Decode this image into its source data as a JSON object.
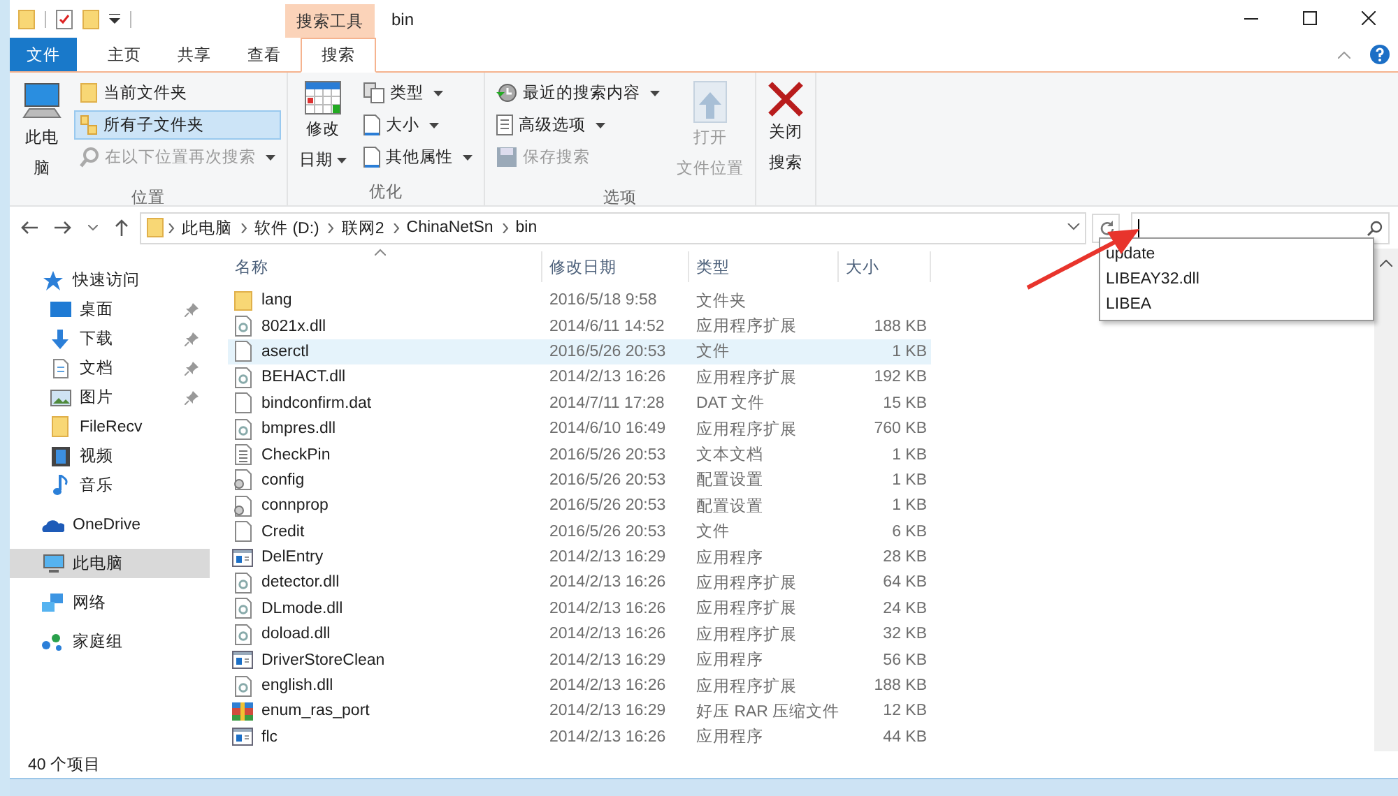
{
  "window": {
    "title": "bin",
    "context_tab": "搜索工具"
  },
  "ribbon_tabs": [
    {
      "label": "文件",
      "kind": "file",
      "selected": false
    },
    {
      "label": "主页",
      "kind": "tab",
      "selected": false
    },
    {
      "label": "共享",
      "kind": "tab",
      "selected": false
    },
    {
      "label": "查看",
      "kind": "tab",
      "selected": false
    },
    {
      "label": "搜索",
      "kind": "tab",
      "selected": true
    }
  ],
  "ribbon_groups": [
    {
      "label": "位置",
      "items": [
        {
          "kind": "large",
          "lines": [
            "此电",
            "脑"
          ],
          "disabled": false,
          "dropdown": false
        },
        {
          "kind": "small",
          "label": "当前文件夹",
          "selected": false,
          "disabled": false,
          "dropdown": false
        },
        {
          "kind": "small",
          "label": "所有子文件夹",
          "selected": true,
          "disabled": false,
          "dropdown": false
        },
        {
          "kind": "small",
          "label": "在以下位置再次搜索",
          "selected": false,
          "disabled": true,
          "dropdown": true
        }
      ]
    },
    {
      "label": "优化",
      "items": [
        {
          "kind": "large",
          "lines": [
            "修改",
            "日期"
          ],
          "disabled": false,
          "dropdown": true
        },
        {
          "kind": "small",
          "label": "类型",
          "selected": false,
          "disabled": false,
          "dropdown": true
        },
        {
          "kind": "small",
          "label": "大小",
          "selected": false,
          "disabled": false,
          "dropdown": true
        },
        {
          "kind": "small",
          "label": "其他属性",
          "selected": false,
          "disabled": false,
          "dropdown": true
        }
      ]
    },
    {
      "label": "选项",
      "items": [
        {
          "kind": "small",
          "label": "最近的搜索内容",
          "selected": false,
          "disabled": false,
          "dropdown": true
        },
        {
          "kind": "small",
          "label": "高级选项",
          "selected": false,
          "disabled": false,
          "dropdown": true
        },
        {
          "kind": "small",
          "label": "保存搜索",
          "selected": false,
          "disabled": true,
          "dropdown": false
        },
        {
          "kind": "large",
          "lines": [
            "打开",
            "文件位置"
          ],
          "disabled": true,
          "dropdown": false
        }
      ]
    },
    {
      "items": [
        {
          "kind": "large",
          "lines": [
            "关闭",
            "搜索"
          ],
          "disabled": false,
          "dropdown": false
        }
      ]
    }
  ],
  "address": {
    "crumbs": [
      "此电脑",
      "软件 (D:)",
      "联网2",
      "ChinaNetSn",
      "bin"
    ]
  },
  "search": {
    "suggestions": [
      "update",
      "LIBEAY32.dll",
      "LIBEA"
    ]
  },
  "navigation": [
    {
      "label": "快速访问",
      "selected": false,
      "children": [
        {
          "label": "桌面",
          "pinned": true
        },
        {
          "label": "下载",
          "pinned": true
        },
        {
          "label": "文档",
          "pinned": true
        },
        {
          "label": "图片",
          "pinned": true
        },
        {
          "label": "FileRecv",
          "pinned": false
        },
        {
          "label": "视频",
          "pinned": false
        },
        {
          "label": "音乐",
          "pinned": false
        }
      ]
    },
    {
      "label": "OneDrive",
      "selected": false
    },
    {
      "label": "此电脑",
      "selected": true
    },
    {
      "label": "网络",
      "selected": false
    },
    {
      "label": "家庭组",
      "selected": false
    }
  ],
  "table": {
    "columns": [
      {
        "label": "名称",
        "sorted": true
      },
      {
        "label": "修改日期",
        "sorted": false
      },
      {
        "label": "类型",
        "sorted": false
      },
      {
        "label": "大小",
        "sorted": false
      }
    ],
    "rows": [
      {
        "kind": "folder",
        "name": "lang",
        "date": "2016/5/18 9:58",
        "type": "文件夹",
        "selected": false
      },
      {
        "kind": "dll",
        "name": "8021x.dll",
        "date": "2014/6/11 14:52",
        "type": "应用程序扩展",
        "size": "188 KB",
        "selected": false
      },
      {
        "kind": "file",
        "name": "aserctl",
        "date": "2016/5/26 20:53",
        "type": "文件",
        "size": "1 KB",
        "selected": true
      },
      {
        "kind": "dll",
        "name": "BEHACT.dll",
        "date": "2014/2/13 16:26",
        "type": "应用程序扩展",
        "size": "192 KB",
        "selected": false
      },
      {
        "kind": "file",
        "name": "bindconfirm.dat",
        "date": "2014/7/11 17:28",
        "type": "DAT 文件",
        "size": "15 KB",
        "selected": false
      },
      {
        "kind": "dll",
        "name": "bmpres.dll",
        "date": "2014/6/10 16:49",
        "type": "应用程序扩展",
        "size": "760 KB",
        "selected": false
      },
      {
        "kind": "text",
        "name": "CheckPin",
        "date": "2016/5/26 20:53",
        "type": "文本文档",
        "size": "1 KB",
        "selected": false
      },
      {
        "kind": "config",
        "name": "config",
        "date": "2016/5/26 20:53",
        "type": "配置设置",
        "size": "1 KB",
        "selected": false
      },
      {
        "kind": "config",
        "name": "connprop",
        "date": "2016/5/26 20:53",
        "type": "配置设置",
        "size": "1 KB",
        "selected": false
      },
      {
        "kind": "file",
        "name": "Credit",
        "date": "2016/5/26 20:53",
        "type": "文件",
        "size": "6 KB",
        "selected": false
      },
      {
        "kind": "exe",
        "name": "DelEntry",
        "date": "2014/2/13 16:29",
        "type": "应用程序",
        "size": "28 KB",
        "selected": false
      },
      {
        "kind": "dll",
        "name": "detector.dll",
        "date": "2014/2/13 16:26",
        "type": "应用程序扩展",
        "size": "64 KB",
        "selected": false
      },
      {
        "kind": "dll",
        "name": "DLmode.dll",
        "date": "2014/2/13 16:26",
        "type": "应用程序扩展",
        "size": "24 KB",
        "selected": false
      },
      {
        "kind": "dll",
        "name": "doload.dll",
        "date": "2014/2/13 16:26",
        "type": "应用程序扩展",
        "size": "32 KB",
        "selected": false
      },
      {
        "kind": "exe",
        "name": "DriverStoreClean",
        "date": "2014/2/13 16:29",
        "type": "应用程序",
        "size": "56 KB",
        "selected": false
      },
      {
        "kind": "dll",
        "name": "english.dll",
        "date": "2014/2/13 16:26",
        "type": "应用程序扩展",
        "size": "188 KB",
        "selected": false
      },
      {
        "kind": "rar",
        "name": "enum_ras_port",
        "date": "2014/2/13 16:29",
        "type": "好压 RAR 压缩文件",
        "size": "12 KB",
        "selected": false
      },
      {
        "kind": "exe",
        "name": "flc",
        "date": "2014/2/13 16:26",
        "type": "应用程序",
        "size": "44 KB",
        "selected": false
      }
    ]
  },
  "status_bar": {
    "count": "40 个项目"
  }
}
